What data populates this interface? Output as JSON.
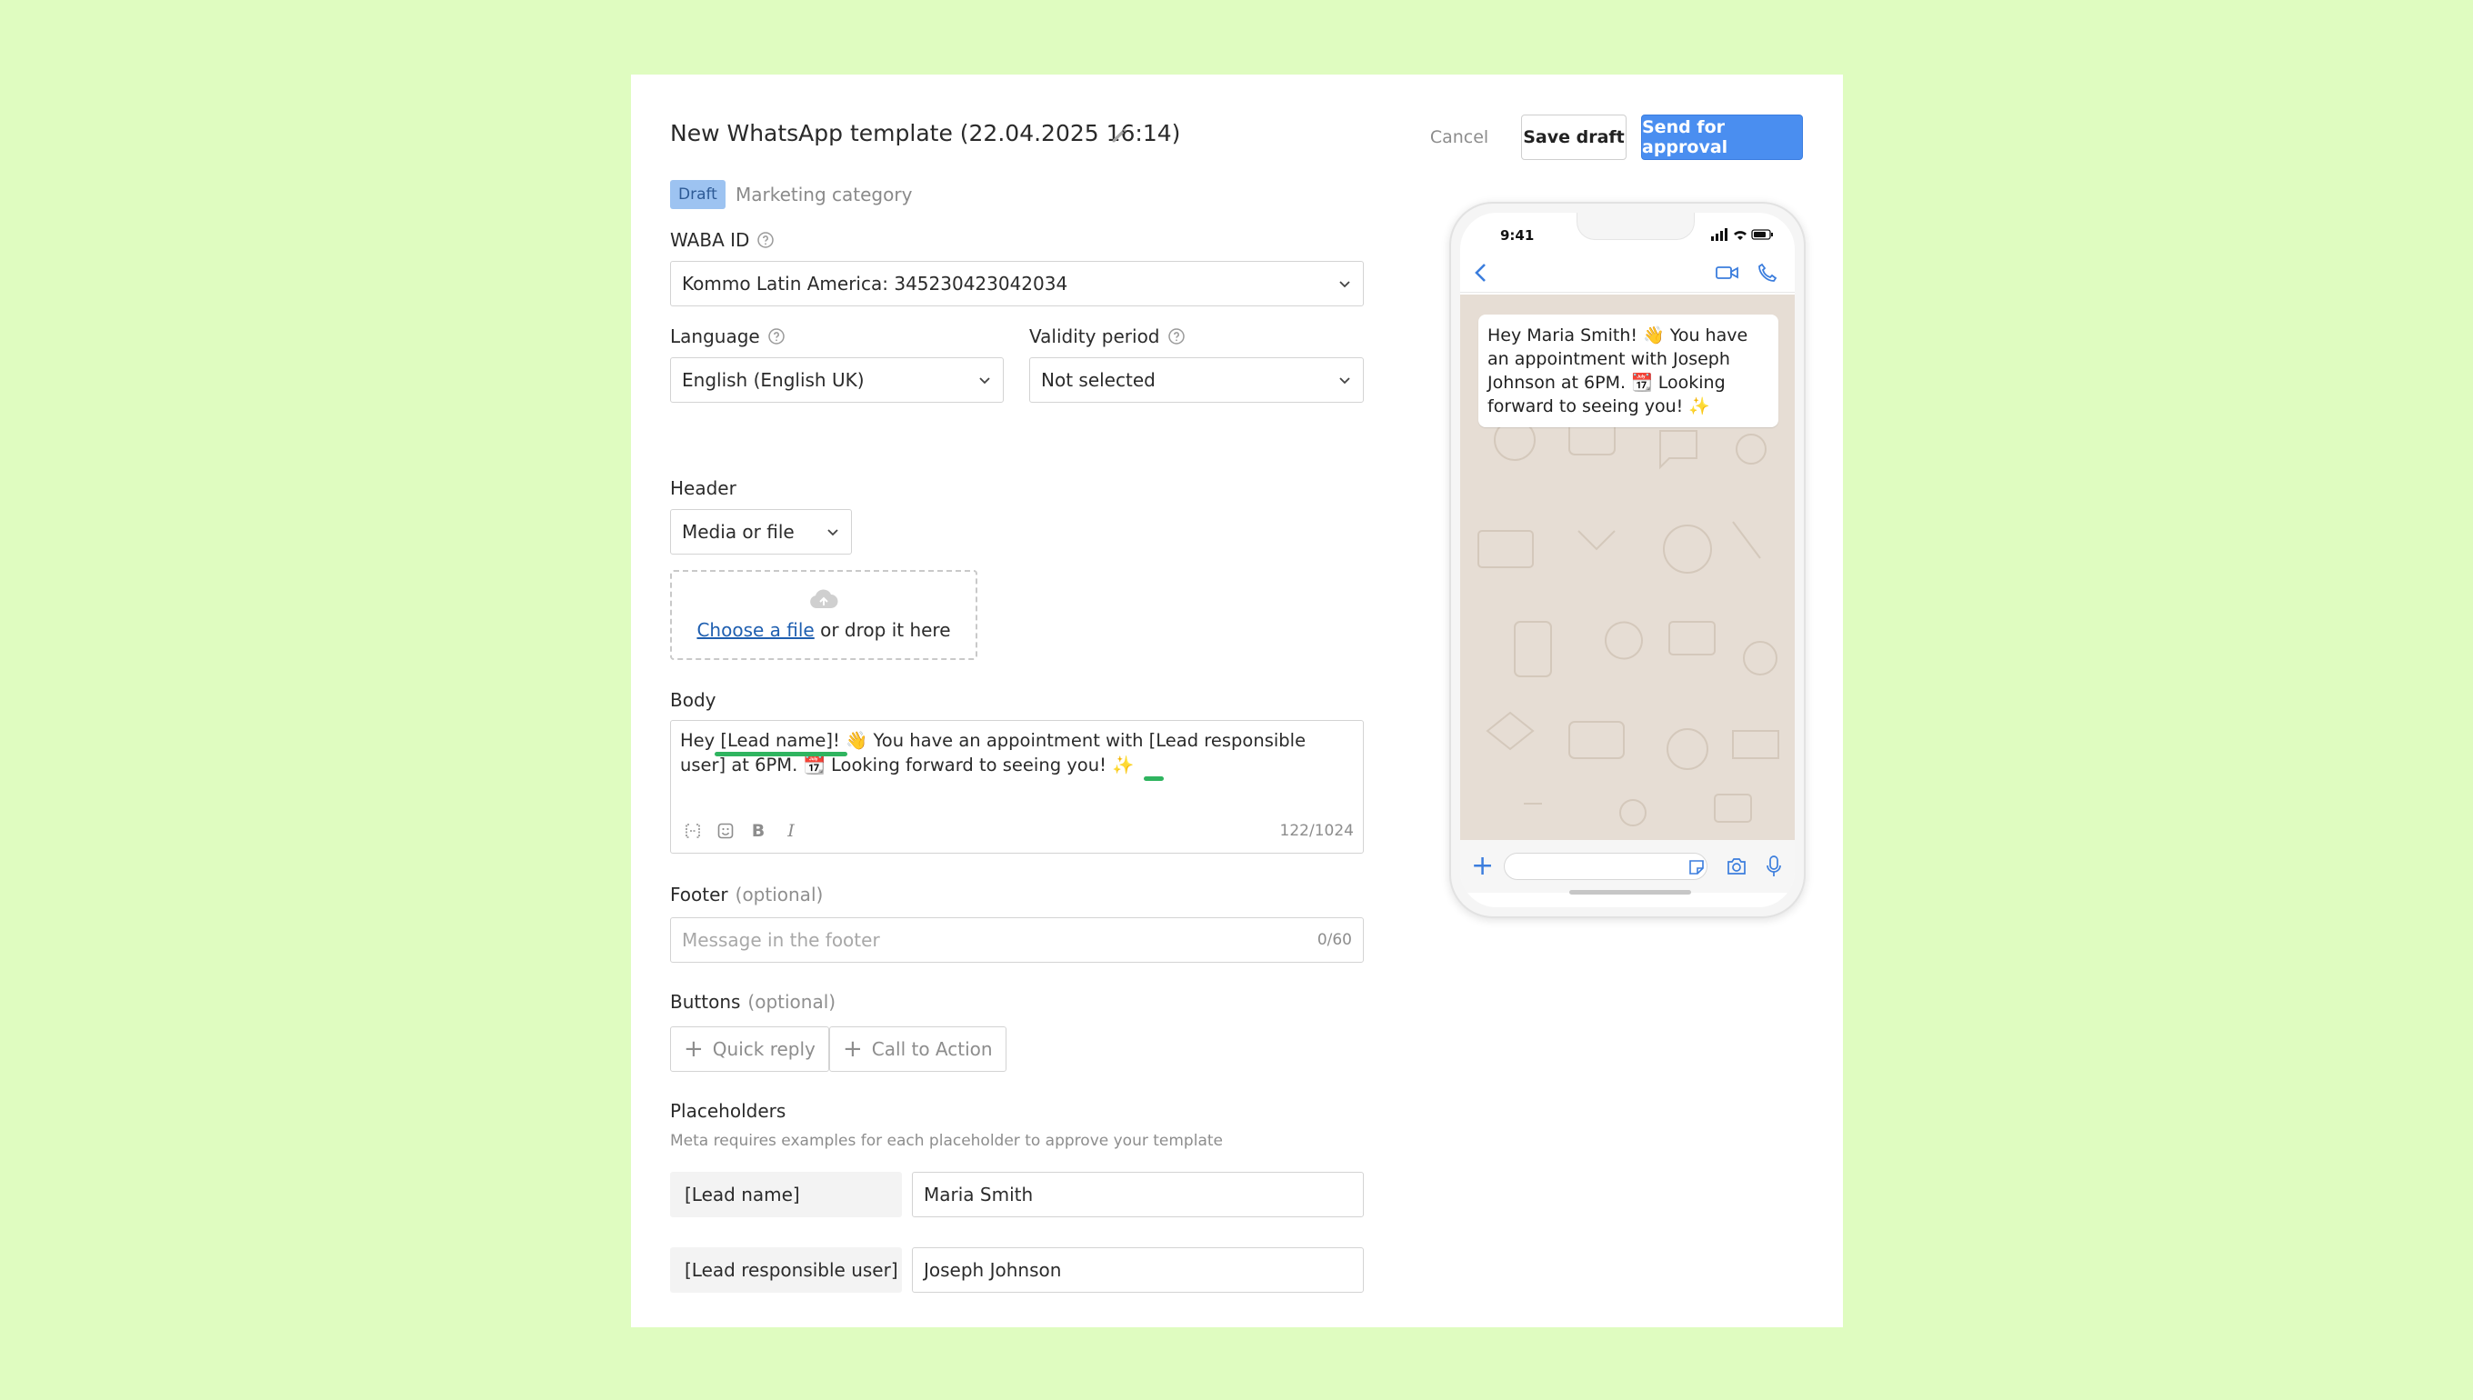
{
  "header": {
    "title": "New WhatsApp template (22.04.2025 16:14)",
    "cancel_label": "Cancel",
    "save_label": "Save draft",
    "send_label": "Send for approval"
  },
  "status": {
    "badge": "Draft",
    "category": "Marketing category"
  },
  "waba": {
    "label": "WABA ID",
    "value": "Kommo Latin America: 345230423042034"
  },
  "language": {
    "label": "Language",
    "value": "English (English UK)"
  },
  "validity": {
    "label": "Validity period",
    "value": "Not selected"
  },
  "header_section": {
    "label": "Header",
    "value": "Media or file",
    "choose_link": "Choose a file",
    "drop_text": "or drop it here"
  },
  "body": {
    "label": "Body",
    "t1": "Hey ",
    "ph1": "[Lead name]",
    "t2": "! 👋 You have an appointment with ",
    "ph2": "[Lead responsible user]",
    "t3": " at 6PM. 📆 Looking forward to seeing you! ✨",
    "counter": "122/1024",
    "tool_bold": "B",
    "tool_italic": "I"
  },
  "footer": {
    "label": "Footer",
    "optional": "(optional)",
    "placeholder": "Message in the footer",
    "counter": "0/60"
  },
  "buttons": {
    "label": "Buttons",
    "optional": "(optional)",
    "quick_reply": "Quick reply",
    "call_to_action": "Call to Action"
  },
  "placeholders": {
    "label": "Placeholders",
    "hint": "Meta requires examples for each placeholder to approve your template",
    "rows": [
      {
        "key": "[Lead name]",
        "value": "Maria Smith"
      },
      {
        "key": "[Lead responsible user]",
        "value": "Joseph Johnson"
      }
    ]
  },
  "phone": {
    "time": "9:41",
    "message": "Hey Maria Smith! 👋 You have an appointment with Joseph Johnson at 6PM. 📆 Looking forward to seeing you! ✨"
  },
  "colors": {
    "background": "#dffcc0",
    "primary": "#4a8ef0",
    "placeholder_underline": "#2fb45f",
    "chat_background": "#e6ddd4"
  }
}
